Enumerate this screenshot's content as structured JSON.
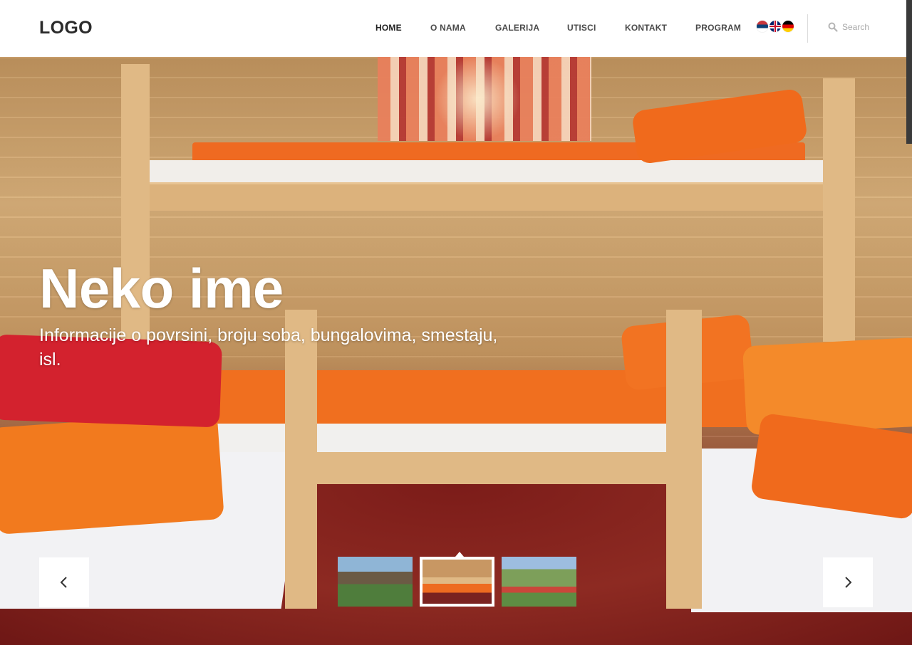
{
  "header": {
    "logo": "LOGO",
    "nav": [
      {
        "label": "HOME",
        "active": true
      },
      {
        "label": "O NAMA",
        "active": false
      },
      {
        "label": "GALERIJA",
        "active": false
      },
      {
        "label": "UTISCI",
        "active": false
      },
      {
        "label": "KONTAKT",
        "active": false
      },
      {
        "label": "PROGRAM",
        "active": false
      }
    ],
    "languages": [
      "flag-serbia-icon",
      "flag-uk-icon",
      "flag-germany-icon"
    ],
    "search": {
      "placeholder": "Search",
      "icon": "search-icon"
    }
  },
  "hero": {
    "title": "Neko ime",
    "subtitle": "Informacije o povrsini, broju soba, bungalovima, smestaju, isl.",
    "prev_icon": "chevron-left-icon",
    "next_icon": "chevron-right-icon",
    "thumbnails": [
      {
        "name": "thumbnail-village",
        "active": false
      },
      {
        "name": "thumbnail-bunk-room",
        "active": true
      },
      {
        "name": "thumbnail-gazebo",
        "active": false
      }
    ]
  },
  "colors": {
    "nav_text": "#4a4a4a",
    "hero_text": "#ffffff",
    "accent_orange": "#ef6a21",
    "carpet_red": "#7a2220"
  }
}
